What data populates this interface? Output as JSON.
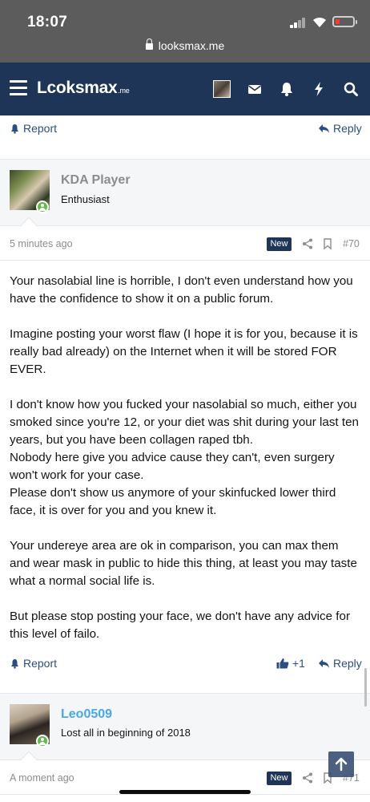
{
  "status_bar": {
    "time": "18:07",
    "url": "looksmax.me",
    "battery_color": "#ff3b30"
  },
  "nav": {
    "logo_main": "Lcoksmax",
    "logo_suffix": ".me",
    "icons": [
      "menu-icon",
      "avatar",
      "mail-icon",
      "bell-icon",
      "bolt-icon",
      "search-icon"
    ],
    "bg_color": "#1f3557"
  },
  "prev_post_footer": {
    "report_label": "Report",
    "reply_label": "Reply"
  },
  "post_70": {
    "username": "KDA Player",
    "user_title": "Enthusiast",
    "username_color": "#8c8c8c",
    "time": "5 minutes ago",
    "badge": "New",
    "number": "#70",
    "paragraphs": [
      "Your nasolabial line is horrible, I don't even understand how you have the confidence to show it on a public forum.",
      "Imagine posting your worst flaw (I hope it is for you, because it is really bad already) on the Internet when it will be stored FOR EVER.",
      "I don't know how you fucked your nasolabial so much, either you smoked since you're 12, or your diet was shit during your last ten years, but you have been collagen raped tbh.",
      "Nobody here give you advice cause they can't, even surgery won't work for your case.",
      "Please don't show us anymore of your skinfucked lower third face, it is over for you and you knew it.",
      "Your undereye area are ok in comparison, you can max them and wear mask in public to hide this thing, at least you may taste what a normal social life is.",
      "But please stop posting your face, we don't have any advice for this level of failo."
    ],
    "report_label": "Report",
    "like_count": "+1",
    "reply_label": "Reply"
  },
  "post_71": {
    "username": "Leo0509",
    "user_title": "Lost all in beginning of 2018",
    "username_color": "#47a7eb",
    "time": "A moment ago",
    "badge": "New",
    "number": "#71"
  },
  "colors": {
    "link": "#2a4e7f",
    "online": "#63b949"
  }
}
